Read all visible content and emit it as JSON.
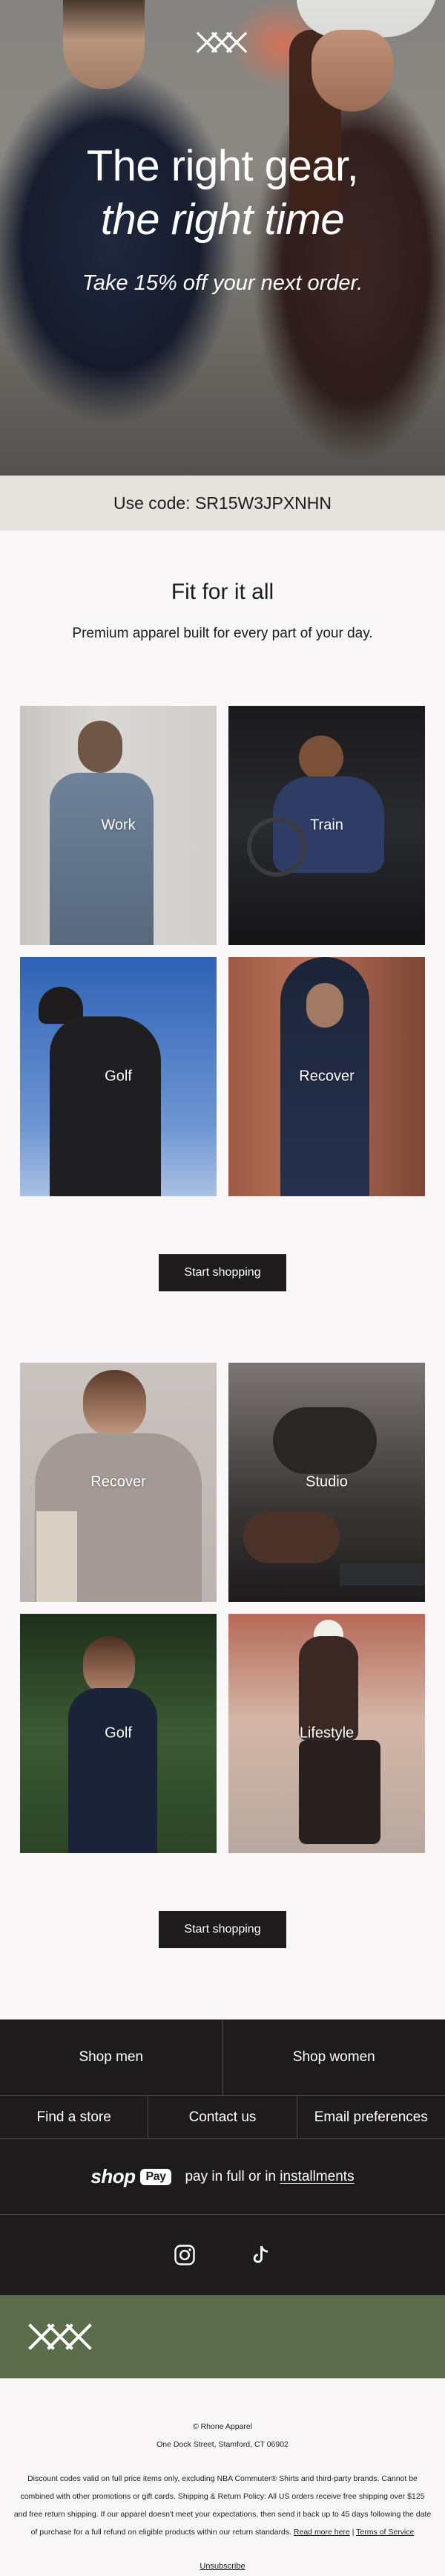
{
  "hero": {
    "title_line1": "The right gear,",
    "title_line2": "the right time",
    "subtitle": "Take 15% off your next order."
  },
  "promo": {
    "code_text": "Use code: SR15W3JPXNHN"
  },
  "section": {
    "title": "Fit for it all",
    "subtitle": "Premium apparel built for every part of your day."
  },
  "grid1": [
    {
      "label": "Work"
    },
    {
      "label": "Train"
    },
    {
      "label": "Golf"
    },
    {
      "label": "Recover"
    }
  ],
  "grid2": [
    {
      "label": "Recover"
    },
    {
      "label": "Studio"
    },
    {
      "label": "Golf"
    },
    {
      "label": "Lifestyle"
    }
  ],
  "cta": {
    "label": "Start shopping"
  },
  "footer": {
    "shop_men": "Shop men",
    "shop_women": "Shop women",
    "find_store": "Find a store",
    "contact": "Contact us",
    "email_prefs": "Email preferences",
    "shop_pay_word": "shop",
    "shop_pay_pill": "Pay",
    "pay_text": "pay in full or in",
    "pay_link": "installments",
    "social_icons": [
      "instagram-icon",
      "tiktok-icon"
    ]
  },
  "legal": {
    "company": "© Rhone Apparel",
    "address": "One Dock Street, Stamford, CT 06902",
    "disclaimer": "Discount codes valid on full price items only, excluding NBA Commuter® Shirts and third-party brands. Cannot be combined with other promotions or gift cards. Shipping & Return Policy: All US orders receive free shipping over $125 and free return shipping. If our apparel doesn't meet your expectations, then send it back up to 45 days following the date of purchase for a full refund on eligible products within our return standards.",
    "read_more": "Read more here",
    "separator": " | ",
    "terms": "Terms of Service",
    "unsubscribe": "Unsubscribe"
  },
  "colors": {
    "dark": "#1d1b1c",
    "code_bar": "#e6e3dd",
    "green_band": "#5c6d4c",
    "page_bg": "#f9f7f7"
  }
}
